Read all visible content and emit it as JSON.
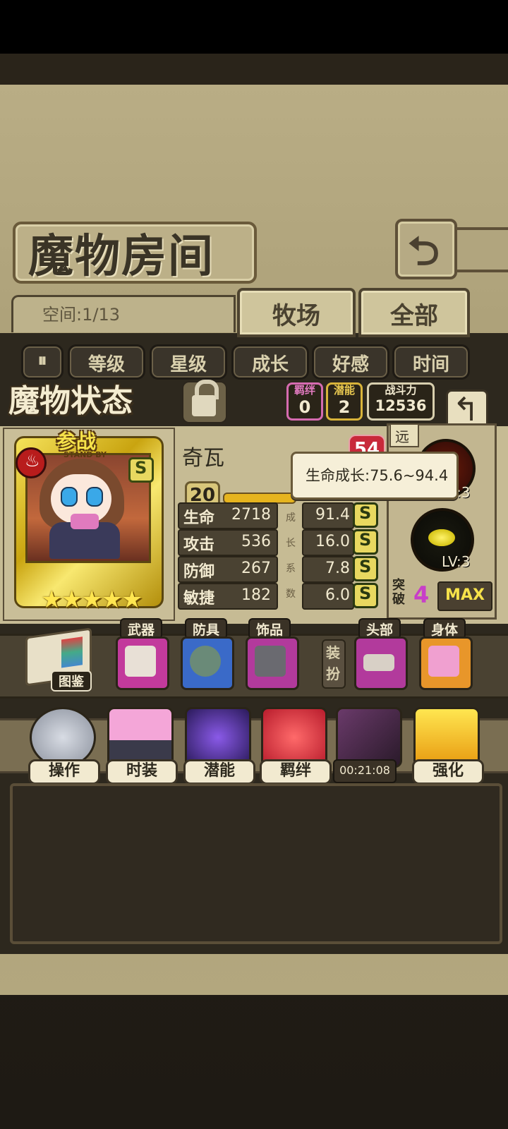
{
  "header": {
    "title": "魔物房间",
    "back_icon": "return-arrow-icon",
    "space_text": "空间:1/13",
    "tabs": [
      {
        "label": "牧场"
      },
      {
        "label": "全部"
      }
    ]
  },
  "sort": {
    "buttons": [
      {
        "label": "等级"
      },
      {
        "label": "星级"
      },
      {
        "label": "成长"
      },
      {
        "label": "好感"
      },
      {
        "label": "时间"
      }
    ]
  },
  "status": {
    "title": "魔物状态",
    "bond_label": "羁绊",
    "bond_value": "0",
    "potential_label": "潜能",
    "potential_value": "2",
    "power_label": "战斗力",
    "power_value": "12536"
  },
  "monster": {
    "standby": "参战",
    "standby_sub": "STAND BY",
    "rank": "S",
    "stars": "★★★★★",
    "star_count": 5,
    "name": "奇瓦",
    "level_badge": "54",
    "level": "20",
    "tooltip": "生命成长:75.6~94.4",
    "stats": [
      {
        "label": "生命",
        "value": "2718",
        "growth": "91.4",
        "grade": "S"
      },
      {
        "label": "攻击",
        "value": "536",
        "growth": "16.0",
        "grade": "S"
      },
      {
        "label": "防御",
        "value": "267",
        "growth": "7.8",
        "grade": "S"
      },
      {
        "label": "敏捷",
        "value": "182",
        "growth": "6.0",
        "grade": "S"
      }
    ],
    "growth_label_chars": [
      "成",
      "长",
      "系",
      "数"
    ]
  },
  "skills": {
    "range": "远",
    "skill1_level": "LV:3",
    "skill2_level": "LV:3",
    "breakthrough_label": "突破",
    "breakthrough_value": "4",
    "max_label": "MAX"
  },
  "equipment": {
    "book_label": "图鉴",
    "dress_label": "装扮",
    "slots": [
      {
        "label": "武器",
        "icon": "weapon-icon"
      },
      {
        "label": "防具",
        "icon": "armor-icon"
      },
      {
        "label": "饰品",
        "icon": "accessory-icon"
      },
      {
        "label": "头部",
        "icon": "tiara-icon"
      },
      {
        "label": "身体",
        "icon": "bow-top-icon"
      }
    ]
  },
  "actions": [
    {
      "label": "操作",
      "icon": "gear-icon"
    },
    {
      "label": "时装",
      "icon": "outfit-icon"
    },
    {
      "label": "潜能",
      "icon": "demon-icon"
    },
    {
      "label": "羁绊",
      "icon": "heart-gem-icon"
    },
    {
      "label": "",
      "icon": "swap-icon",
      "timer": "00:21:08"
    },
    {
      "label": "强化",
      "icon": "upgrade-arrows-icon"
    }
  ],
  "colors": {
    "paper": "#b9ad85",
    "dark": "#2d281e",
    "accent_gold": "#f6e24a",
    "bond_border": "#d66bb0",
    "potential_border": "#d9b43a"
  }
}
